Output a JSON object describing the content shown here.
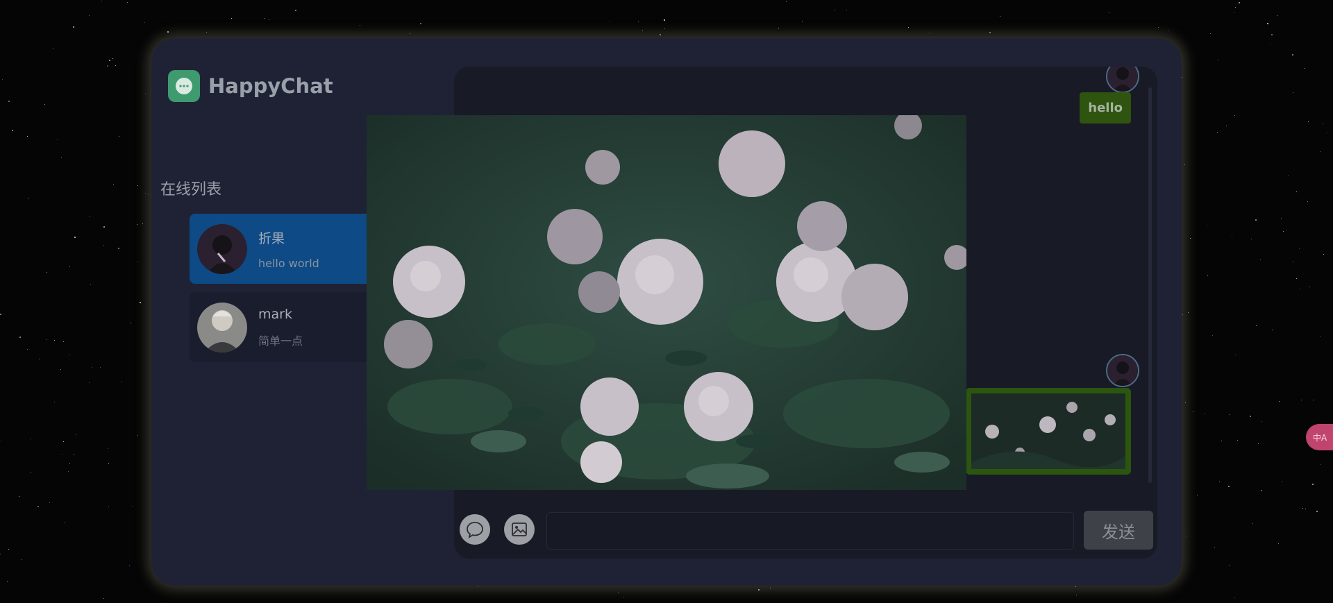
{
  "app": {
    "title": "HappyChat"
  },
  "sidebar": {
    "section_title": "在线列表",
    "contacts": [
      {
        "name": "折果",
        "last_message": "hello world",
        "active": true
      },
      {
        "name": "mark",
        "last_message": "简单一点",
        "active": false
      }
    ]
  },
  "chat": {
    "messages": [
      {
        "type": "text",
        "text": "hello"
      },
      {
        "type": "image",
        "alt": ""
      }
    ],
    "input": {
      "value": "",
      "placeholder": ""
    },
    "send_label": "发送"
  },
  "colors": {
    "accent_active": "#0e4a86",
    "bubble_green": "#2e5410",
    "background": "#1f2235"
  },
  "icons": [
    "chat-bubble-icon",
    "image-icon",
    "translate-icon"
  ],
  "translate_badge": {
    "label": "中A"
  }
}
